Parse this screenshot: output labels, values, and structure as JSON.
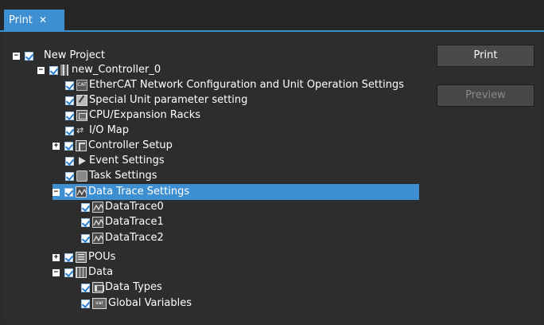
{
  "tab": {
    "title": "Print",
    "close": "✕"
  },
  "buttons": {
    "print": "Print",
    "preview": "Preview"
  },
  "tree": {
    "root": "New Project",
    "controller": "new_Controller_0",
    "items": {
      "ethercat": "EtherCAT Network Configuration and Unit Operation Settings",
      "special_unit": "Special Unit parameter setting",
      "cpu_racks": "CPU/Expansion Racks",
      "io_map": "I/O Map",
      "controller_setup": "Controller Setup",
      "event_settings": "Event Settings",
      "task_settings": "Task Settings",
      "data_trace_settings": "Data Trace Settings",
      "data_trace_0": "DataTrace0",
      "data_trace_1": "DataTrace1",
      "data_trace_2": "DataTrace2",
      "pous": "POUs",
      "data": "Data",
      "data_types": "Data Types",
      "global_variables": "Global Variables"
    },
    "icon_text": {
      "ethercat": "CAT",
      "global_variables": "var"
    },
    "toggles": {
      "expanded": "−",
      "collapsed": "+"
    },
    "selected_item": "Data Trace Settings"
  },
  "colors": {
    "accent": "#3d8fd1",
    "background": "#2d2d2d"
  }
}
